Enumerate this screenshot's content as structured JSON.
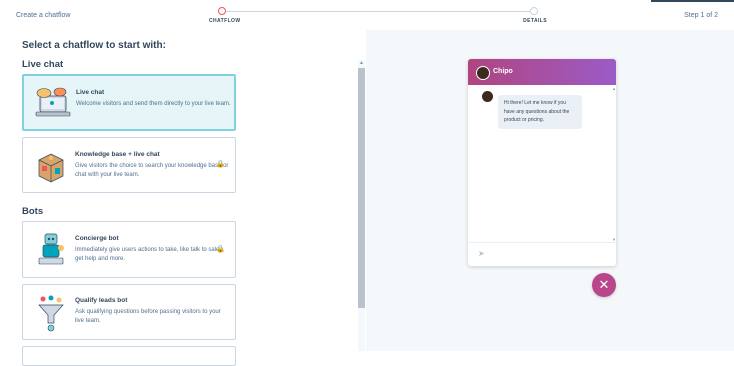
{
  "header": {
    "breadcrumb": "Create a chatflow",
    "step_count": "Step 1 of 2",
    "steps": [
      {
        "label": "CHATFLOW"
      },
      {
        "label": "DETAILS"
      }
    ]
  },
  "main": {
    "heading": "Select a chatflow to start with:",
    "sections": {
      "live_chat": "Live chat",
      "bots": "Bots"
    },
    "cards": [
      {
        "title": "Live chat",
        "description": "Welcome visitors and send them directly to your live team."
      },
      {
        "title": "Knowledge base + live chat",
        "description": "Give visitors the choice to search your knowledge base or chat with your live team."
      },
      {
        "title": "Concierge bot",
        "description": "Immediately give users actions to take, like talk to sales, get help and more."
      },
      {
        "title": "Qualify leads bot",
        "description": "Ask qualifying questions before passing visitors to your live team."
      }
    ]
  },
  "preview": {
    "agent_name": "Chipo",
    "message": "Hi there! Let me know if you have any questions about the product or pricing."
  },
  "colors": {
    "accent": "#f2545b",
    "selected_border": "#7fd1de",
    "header_gradient_start": "#b0457f",
    "header_gradient_end": "#9b5bc7",
    "close_button": "#b9468a"
  },
  "icons": [
    "lock-icon",
    "send-icon",
    "close-icon",
    "scroll-up-icon",
    "scroll-down-icon"
  ]
}
